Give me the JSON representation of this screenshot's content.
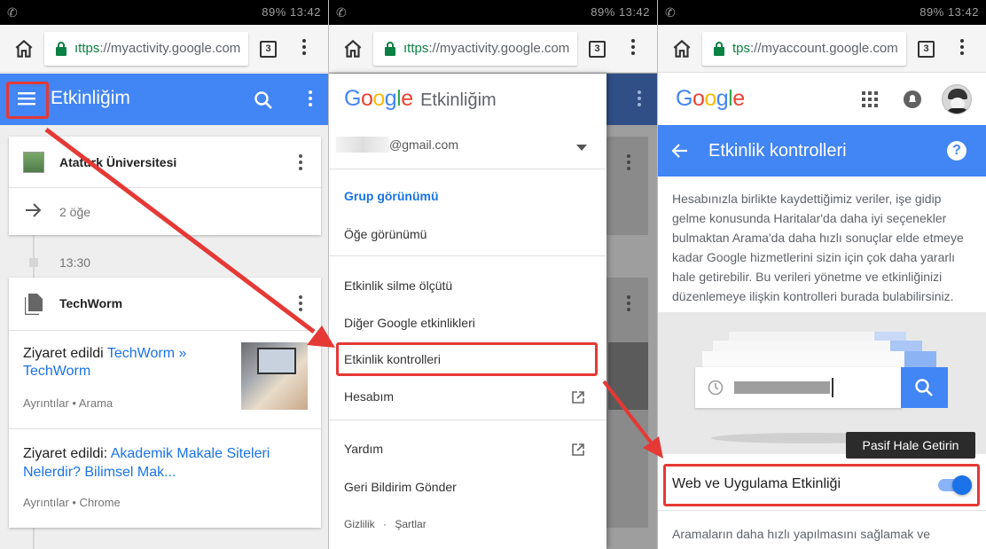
{
  "status_bar": {
    "battery": "89%",
    "time": "13:42"
  },
  "panel1": {
    "url_scheme": "ıttps",
    "url_rest": "://myactivity.google.com",
    "tab_count": "3",
    "app_title": "Etkinliğim",
    "card1": {
      "title": "Atatürk Üniversitesi",
      "sub": "2 öğe"
    },
    "timeline_time": "13:30",
    "card2": {
      "title": "TechWorm",
      "entry1": {
        "prefix": "Ziyaret edildi",
        "link": "TechWorm » TechWorm",
        "meta": "Ayrıntılar • Arama"
      },
      "entry2": {
        "prefix": "Ziyaret edildi:",
        "link": "Akademik Makale Siteleri Nelerdir? Bilimsel Mak...",
        "meta": "Ayrıntılar • Chrome"
      }
    }
  },
  "panel2": {
    "url_scheme": "ıttps",
    "url_rest": "://myactivity.google.com",
    "tab_count": "3",
    "drawer_logo": "Google",
    "drawer_title": "Etkinliğim",
    "account_email": "@gmail.com",
    "items": {
      "group_view": "Grup görünümü",
      "item_view": "Öğe görünümü",
      "delete_by": "Etkinlik silme ölçütü",
      "other_google": "Diğer Google etkinlikleri",
      "activity_controls": "Etkinlik kontrolleri",
      "my_account": "Hesabım",
      "help": "Yardım",
      "feedback": "Geri Bildirim Gönder",
      "privacy": "Gizlilik",
      "terms": "Şartlar",
      "dot": "·"
    }
  },
  "panel3": {
    "url_scheme": "tps",
    "url_rest": "://myaccount.google.com",
    "tab_count": "3",
    "logo": "Google",
    "header_title": "Etkinlik kontrolleri",
    "description": "Hesabınızla birlikte kaydettiğimiz veriler, işe gidip gelme konusunda Haritalar'da daha iyi seçenekler bulmaktan Arama'da daha hızlı sonuçlar elde etmeye kadar Google hizmetlerini sizin için çok daha yararlı hale getirebilir. Bu verileri yönetme ve etkinliğinizi düzenlemeye ilişkin kontrolleri burada bulabilirsiniz.",
    "tooltip": "Pasif Hale Getirin",
    "toggle_label": "Web ve Uygulama Etkinliği",
    "toggle_on": true,
    "bottom_text": "Aramaların daha hızlı yapılmasını sağlamak ve"
  },
  "colors": {
    "google_blue": "#4285f4",
    "annotation_red": "#e53935",
    "link_blue": "#1a73e8"
  }
}
